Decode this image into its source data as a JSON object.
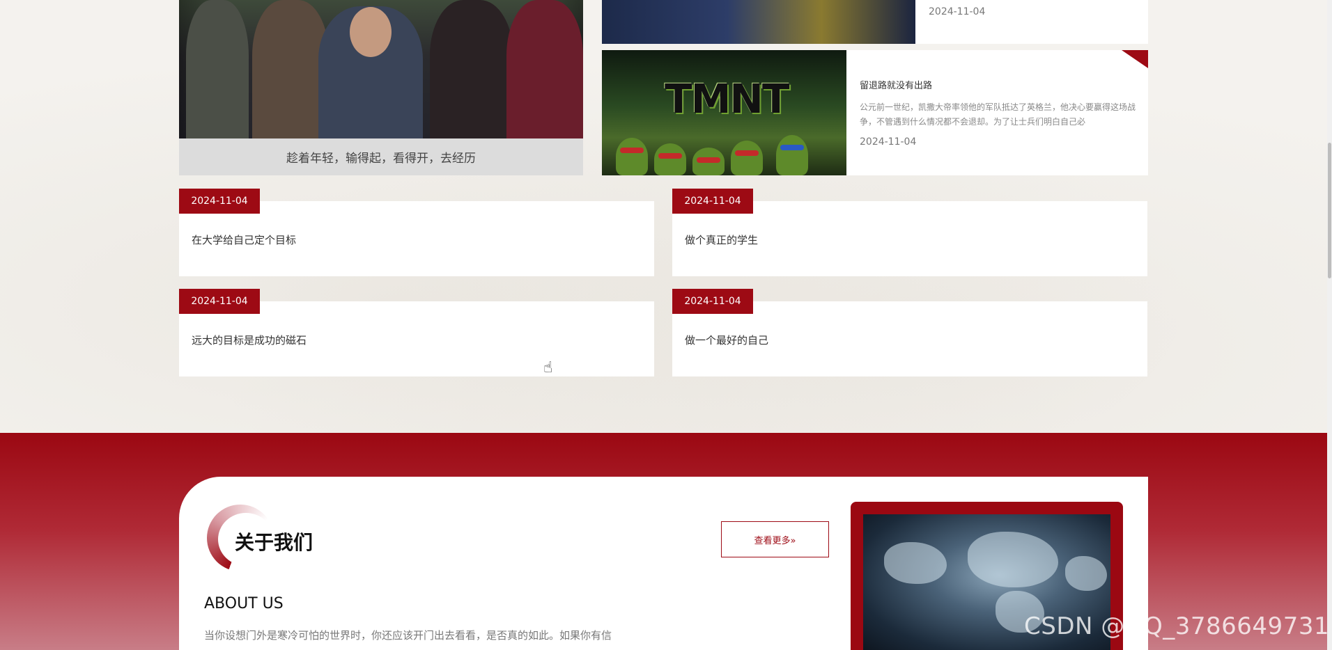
{
  "news": {
    "feature": {
      "caption": "趁着年轻，输得起，看得开，去经历"
    },
    "side_items": [
      {
        "date": "2024-11-04"
      },
      {
        "thumb_text": "TMNT",
        "title": "留退路就没有出路",
        "description": "公元前一世纪，凯撒大帝率领他的军队抵达了英格兰，他决心要赢得这场战争，不管遇到什么情况都不会退却。为了让士兵们明白自己必",
        "date": "2024-11-04"
      }
    ]
  },
  "cards": [
    {
      "date": "2024-11-04",
      "title": "在大学给自己定个目标"
    },
    {
      "date": "2024-11-04",
      "title": "做个真正的学生"
    },
    {
      "date": "2024-11-04",
      "title": "远大的目标是成功的磁石"
    },
    {
      "date": "2024-11-04",
      "title": "做一个最好的自己"
    }
  ],
  "about": {
    "title": "关于我们",
    "subtitle": "ABOUT US",
    "text": "当你设想门外是寒冷可怕的世界时，你还应该开门出去看看，是否真的如此。如果你有信",
    "more_label": "查看更多»"
  },
  "watermark": "CSDN @QQ_3786649731",
  "colors": {
    "accent": "#9d0a14",
    "background": "#f4f2ee"
  }
}
